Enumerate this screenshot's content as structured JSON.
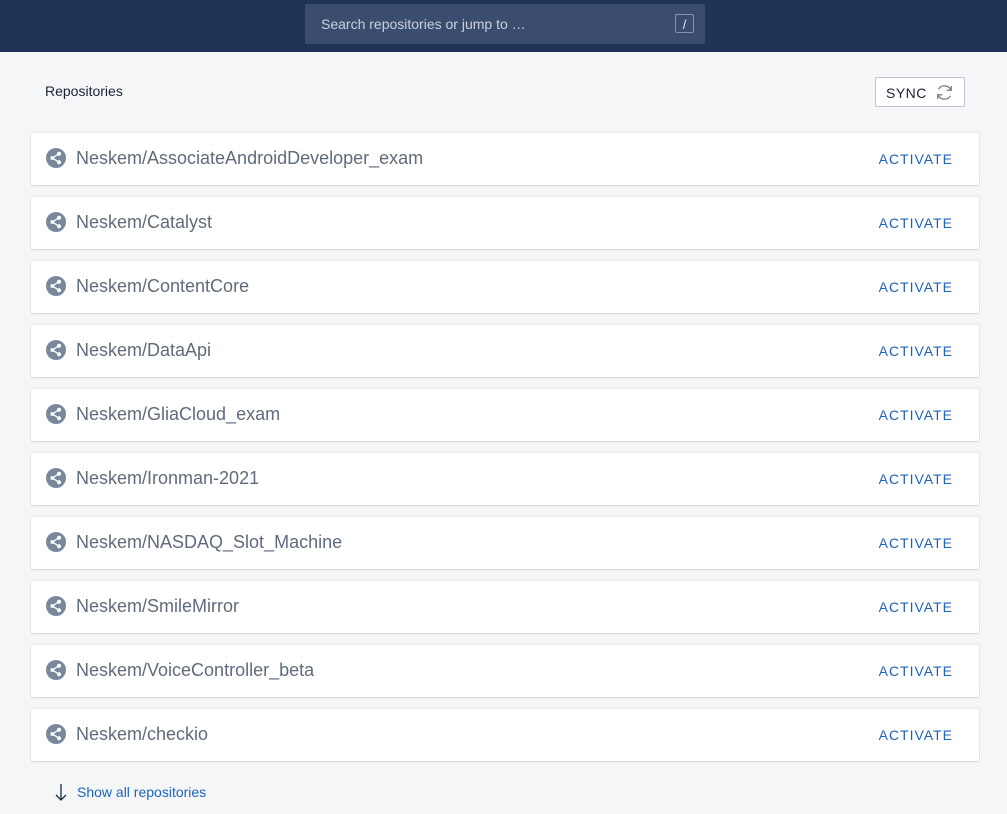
{
  "search": {
    "placeholder": "Search repositories or jump to …",
    "shortcut": "/"
  },
  "header": {
    "title": "Repositories",
    "sync_label": "SYNC",
    "sync_icon": "refresh-icon"
  },
  "repositories": [
    {
      "name": "Neskem/AssociateAndroidDeveloper_exam",
      "action": "ACTIVATE",
      "icon": "share-icon"
    },
    {
      "name": "Neskem/Catalyst",
      "action": "ACTIVATE",
      "icon": "share-icon"
    },
    {
      "name": "Neskem/ContentCore",
      "action": "ACTIVATE",
      "icon": "share-icon"
    },
    {
      "name": "Neskem/DataApi",
      "action": "ACTIVATE",
      "icon": "share-icon"
    },
    {
      "name": "Neskem/GliaCloud_exam",
      "action": "ACTIVATE",
      "icon": "share-icon"
    },
    {
      "name": "Neskem/Ironman-2021",
      "action": "ACTIVATE",
      "icon": "share-icon"
    },
    {
      "name": "Neskem/NASDAQ_Slot_Machine",
      "action": "ACTIVATE",
      "icon": "share-icon"
    },
    {
      "name": "Neskem/SmileMirror",
      "action": "ACTIVATE",
      "icon": "share-icon"
    },
    {
      "name": "Neskem/VoiceController_beta",
      "action": "ACTIVATE",
      "icon": "share-icon"
    },
    {
      "name": "Neskem/checkio",
      "action": "ACTIVATE",
      "icon": "share-icon"
    }
  ],
  "footer": {
    "show_all_label": "Show all repositories",
    "show_all_icon": "arrow-down-icon"
  },
  "colors": {
    "topbar": "#1f3457",
    "link": "#1e63b8",
    "repo_text": "#5f6b7c",
    "background": "#f5f6f8"
  }
}
